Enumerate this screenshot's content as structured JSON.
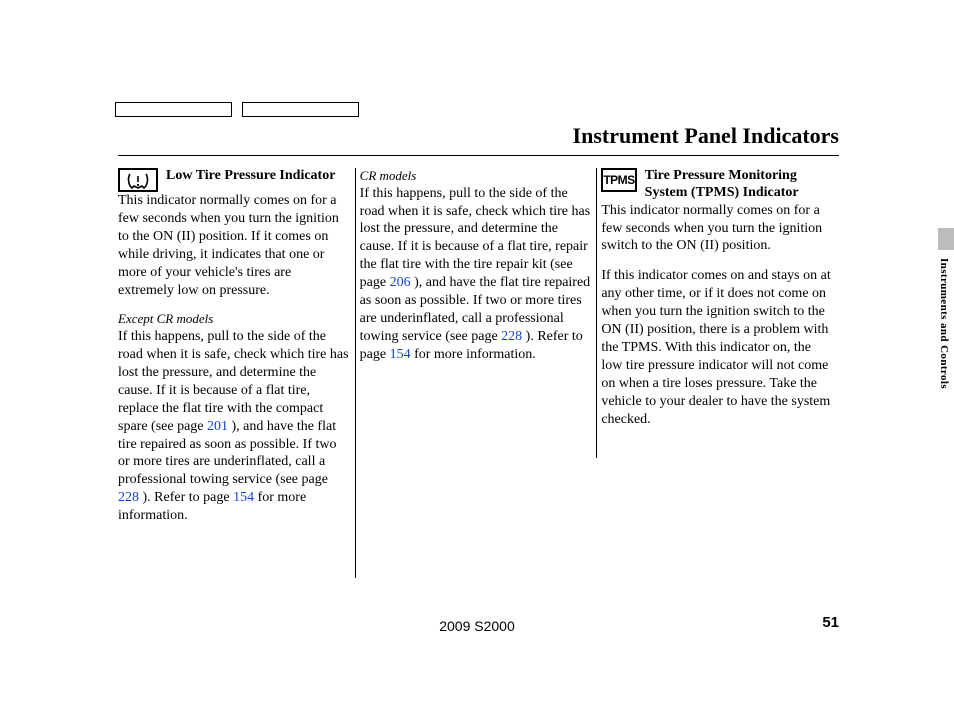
{
  "title": "Instrument Panel Indicators",
  "sideLabel": "Instruments and Controls",
  "footerModel": "2009  S2000",
  "pageNumber": "51",
  "col1": {
    "heading": "Low Tire Pressure Indicator",
    "p1": "This indicator normally comes on for a few seconds when you turn the ignition to the ON (II) position. If it comes on while driving, it indicates that one or more of your vehicle's tires are extremely low on pressure.",
    "sub": "Except CR models",
    "p2a": "If this happens, pull to the side of the road when it is safe, check which tire has lost the pressure, and determine the cause. If it is because of a flat tire, replace the flat tire with the compact spare (see page ",
    "link1": "201",
    "p2b": " ), and have the flat tire repaired as soon as possible. If two or more tires are underinflated, call a professional towing service (see page ",
    "link2": "228",
    "p2c": " ). Refer to page ",
    "link3": "154",
    "p2d": " for more information."
  },
  "col2": {
    "sub": "CR models",
    "p1a": "If this happens, pull to the side of the road when it is safe, check which tire has lost the pressure, and determine the cause. If it is because of a flat tire, repair the flat tire with the tire repair kit (see page ",
    "link1": "206",
    "p1b": " ), and have the flat tire repaired as soon as possible. If two or more tires are underinflated, call a professional towing service (see page ",
    "link2": "228",
    "p1c": " ). Refer to page ",
    "link3": "154",
    "p1d": " for more information."
  },
  "col3": {
    "tpmsLabel": "TPMS",
    "heading": "Tire Pressure Monitoring System (TPMS) Indicator",
    "p1": "This indicator normally comes on for a few seconds when you turn the ignition switch to the ON (II) position.",
    "p2": "If this indicator comes on and stays on at any other time, or if it does not come on when you turn the ignition switch to the ON (II) position, there is a problem with the TPMS. With this indicator on, the low tire pressure indicator will not come on when a tire loses pressure. Take the vehicle to your dealer to have the system checked."
  }
}
